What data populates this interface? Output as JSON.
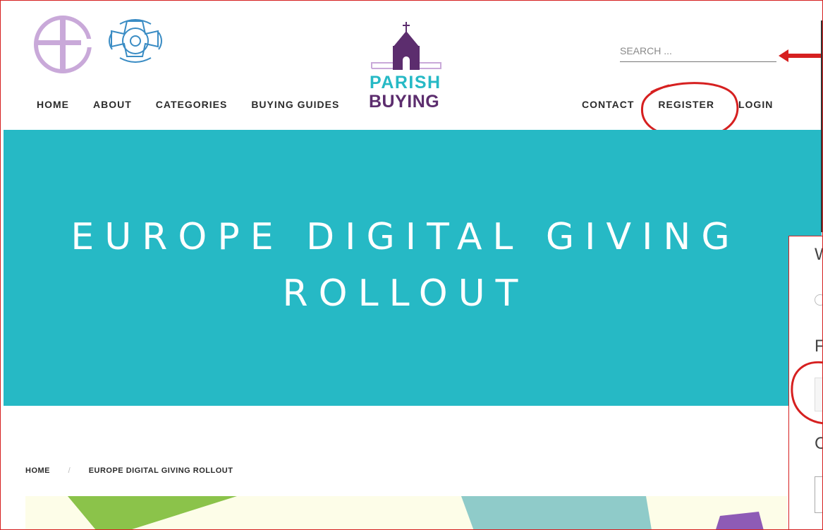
{
  "logo": {
    "line1": "PARISH",
    "line2": "BUYING"
  },
  "nav_left": [
    "HOME",
    "ABOUT",
    "CATEGORIES",
    "BUYING GUIDES"
  ],
  "nav_right": [
    "CONTACT",
    "REGISTER",
    "LOGIN"
  ],
  "search": {
    "placeholder": "SEARCH ..."
  },
  "hero": {
    "title": "EUROPE DIGITAL GIVING ROLLOUT"
  },
  "breadcrumb": {
    "home": "HOME",
    "sep": "/",
    "current": "EUROPE DIGITAL GIVING ROLLOUT"
  },
  "popup": {
    "label1": "W",
    "label2": "F",
    "label3": "C"
  },
  "colors": {
    "teal": "#26b9c5",
    "purple": "#5c2d6e",
    "lilac": "#c9a9d9",
    "annotation_red": "#d62020"
  }
}
